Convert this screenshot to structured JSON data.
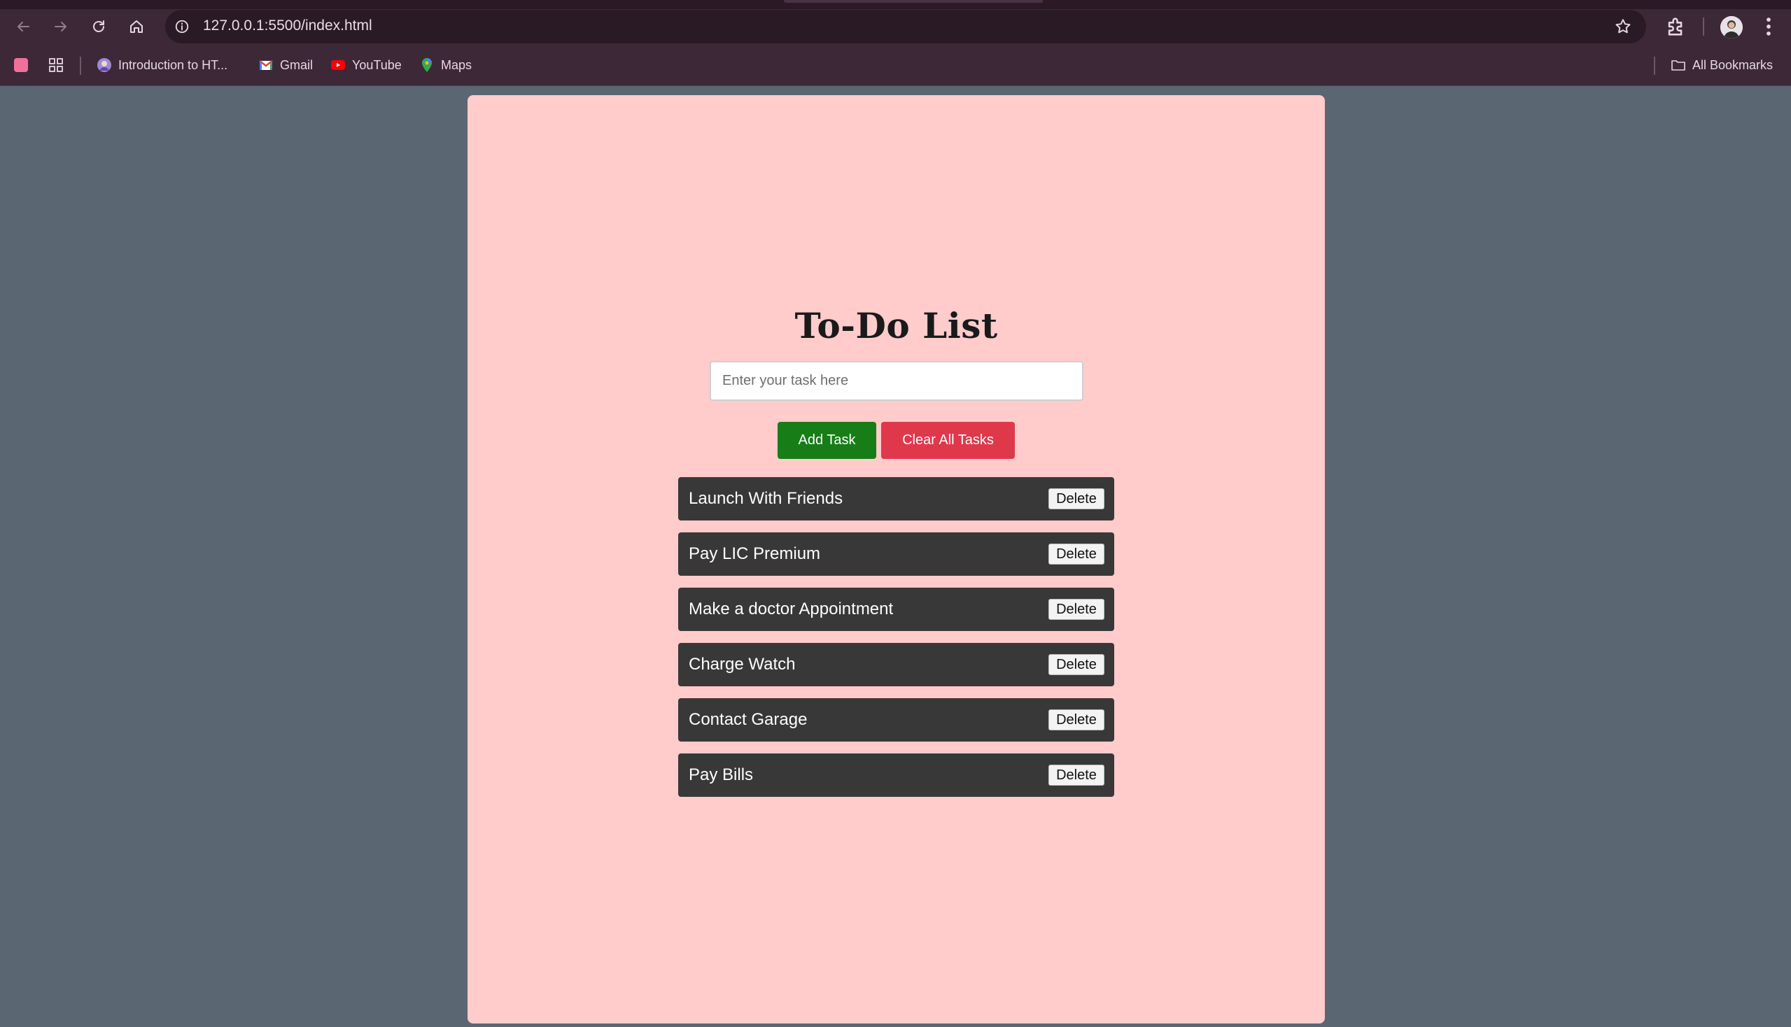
{
  "browser": {
    "url": "127.0.0.1:5500/index.html",
    "bookmarks": [
      {
        "label": "Introduction to HT...",
        "icon": "globe-avatar-icon"
      },
      {
        "label": "Gmail",
        "icon": "gmail-icon"
      },
      {
        "label": "YouTube",
        "icon": "youtube-icon"
      },
      {
        "label": "Maps",
        "icon": "maps-icon"
      }
    ],
    "all_bookmarks_label": "All Bookmarks"
  },
  "app": {
    "title": "To-Do List",
    "input_placeholder": "Enter your task here",
    "input_value": "",
    "add_label": "Add Task",
    "clear_label": "Clear All Tasks",
    "delete_label": "Delete",
    "tasks": [
      "Launch With Friends",
      "Pay LIC Premium",
      "Make a doctor Appointment",
      "Charge Watch",
      "Contact Garage",
      "Pay Bills"
    ]
  },
  "colors": {
    "page_background": "#5b6673",
    "card_background": "#ffcbcb",
    "add_button": "#177d17",
    "clear_button": "#e0384b",
    "task_item": "#383838"
  }
}
